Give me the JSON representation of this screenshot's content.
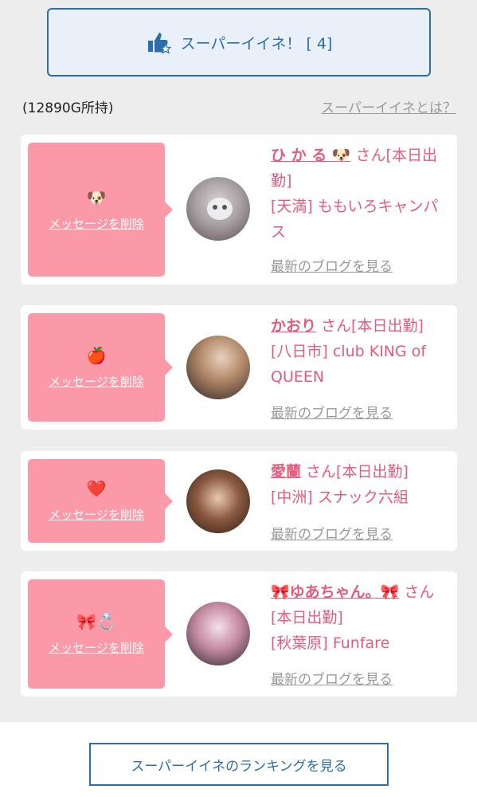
{
  "superlike": {
    "label": "スーパーイイネ！ [ 4]",
    "icon": "thumbs-up-star-icon"
  },
  "points_text": "(12890G所持)",
  "whatis_link": "スーパーイイネとは？",
  "cards": [
    {
      "emoji": "🐶",
      "delete_label": "メッセージを削除",
      "name": "ひ か る 🐶",
      "suffix": " さん[本日出勤]",
      "shop": "[天満] ももいろキャンパス",
      "blog_label": "最新のブログを見る"
    },
    {
      "emoji": "🍎",
      "delete_label": "メッセージを削除",
      "name": "かおり",
      "suffix": " さん[本日出勤]",
      "shop": "[八日市] club KING of QUEEN",
      "blog_label": "最新のブログを見る"
    },
    {
      "emoji": "❤️",
      "delete_label": "メッセージを削除",
      "name": "愛蘭",
      "suffix": " さん[本日出勤]",
      "shop": "[中洲] スナック六組",
      "blog_label": "最新のブログを見る"
    },
    {
      "emoji": "🎀💍",
      "delete_label": "メッセージを削除",
      "name": "🎀ゆあちゃん。🎀",
      "suffix": " さん[本日出勤]",
      "shop": "[秋葉原] Funfare",
      "blog_label": "最新のブログを見る"
    }
  ],
  "ranking_button": "スーパーイイネのランキングを見る",
  "colors": {
    "accent": "#2c6ea9",
    "pink": "#fc99a8",
    "name": "#e35b7d",
    "gray": "#999999"
  }
}
